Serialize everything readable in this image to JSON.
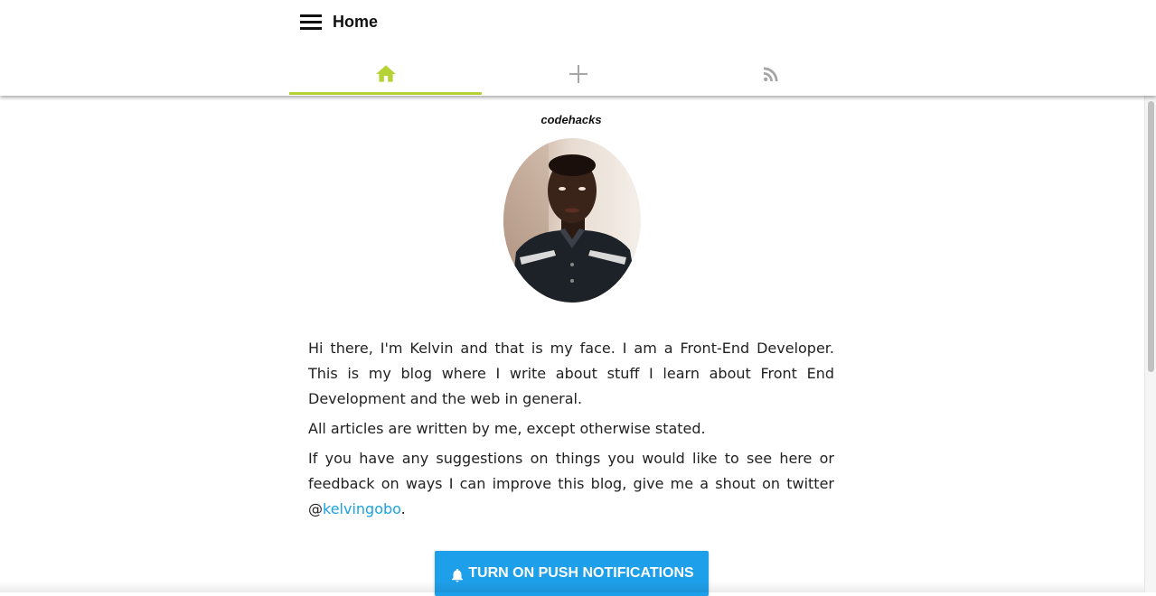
{
  "header": {
    "title": "Home",
    "menu_icon": "hamburger-menu-icon"
  },
  "tabs": [
    {
      "icon": "home-icon",
      "active": true
    },
    {
      "icon": "plus-icon",
      "active": false
    },
    {
      "icon": "rss-icon",
      "active": false
    }
  ],
  "colors": {
    "active_tab": "#b5d334",
    "inactive_tab": "#9e9e9e",
    "link": "#1aa3e0",
    "button": "#1e9fea"
  },
  "profile": {
    "site_name": "codehacks",
    "avatar": "profile-photo"
  },
  "bio": {
    "paragraph1": "Hi there, I'm Kelvin and that is my face. I am a Front-End Developer. This is my blog where I write about stuff I learn about Front End Development and the web in general.",
    "paragraph2": "All articles are written by me, except otherwise stated.",
    "paragraph3_prefix": "If you have any suggestions on things you would like to see here or feedback on ways I can improve this blog, give me a shout on twitter @",
    "twitter_handle": "kelvingobo",
    "paragraph3_suffix": "."
  },
  "push_button": {
    "label": "TURN ON PUSH NOTIFICATIONS",
    "icon": "bell-icon"
  }
}
